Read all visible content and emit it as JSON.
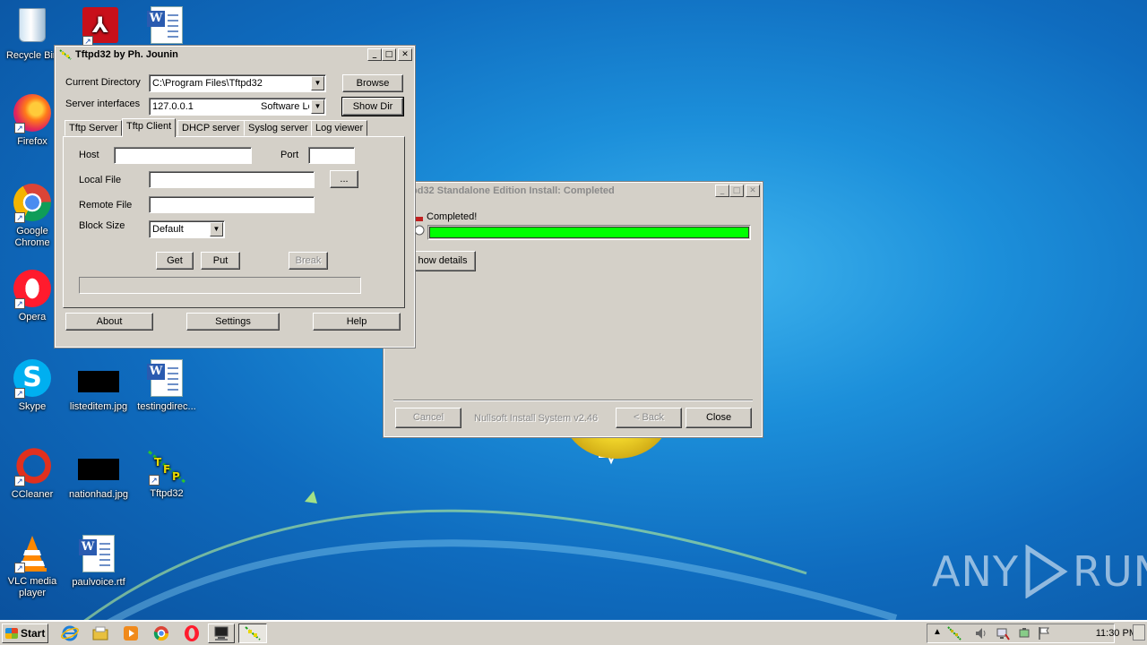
{
  "desktop": {
    "icons": [
      {
        "label": "Recycle Bin"
      },
      {
        "label": "Firefox"
      },
      {
        "label": "Google Chrome"
      },
      {
        "label": "Opera"
      },
      {
        "label": "Skype"
      },
      {
        "label": "listeditem.jpg"
      },
      {
        "label": "testingdirec..."
      },
      {
        "label": "CCleaner"
      },
      {
        "label": "nationhad.jpg"
      },
      {
        "label": "Tftpd32"
      },
      {
        "label": "VLC media player"
      },
      {
        "label": "paulvoice.rtf"
      }
    ],
    "watermark": {
      "left": "ANY",
      "right": "RUN"
    }
  },
  "tftpd": {
    "title": "Tftpd32 by Ph. Jounin",
    "current_directory_label": "Current Directory",
    "current_directory_value": "C:\\Program Files\\Tftpd32",
    "server_interfaces_label": "Server interfaces",
    "server_interface_ip": "127.0.0.1",
    "server_interface_name": "Software Lo",
    "browse_label": "Browse",
    "show_dir_label": "Show Dir",
    "tabs": [
      {
        "label": "Tftp Server"
      },
      {
        "label": "Tftp Client"
      },
      {
        "label": "DHCP server"
      },
      {
        "label": "Syslog server"
      },
      {
        "label": "Log viewer"
      }
    ],
    "client": {
      "host_label": "Host",
      "host_value": "",
      "port_label": "Port",
      "port_value": "",
      "local_file_label": "Local File",
      "local_file_value": "",
      "browse_dots": "...",
      "remote_file_label": "Remote File",
      "remote_file_value": "",
      "block_size_label": "Block Size",
      "block_size_value": "Default",
      "get_label": "Get",
      "put_label": "Put",
      "break_label": "Break"
    },
    "about_label": "About",
    "settings_label": "Settings",
    "help_label": "Help"
  },
  "installer": {
    "title": "pd32 Standalone Edition Install: Completed",
    "status_text": "Completed!",
    "progress": 1.0,
    "progress_color": "#00ff00",
    "show_details_label": "how details",
    "cancel_label": "Cancel",
    "branding": "Nullsoft Install System v2.46",
    "back_label": "< Back",
    "close_label": "Close"
  },
  "taskbar": {
    "start_label": "Start",
    "clock": "11:30 PM"
  }
}
